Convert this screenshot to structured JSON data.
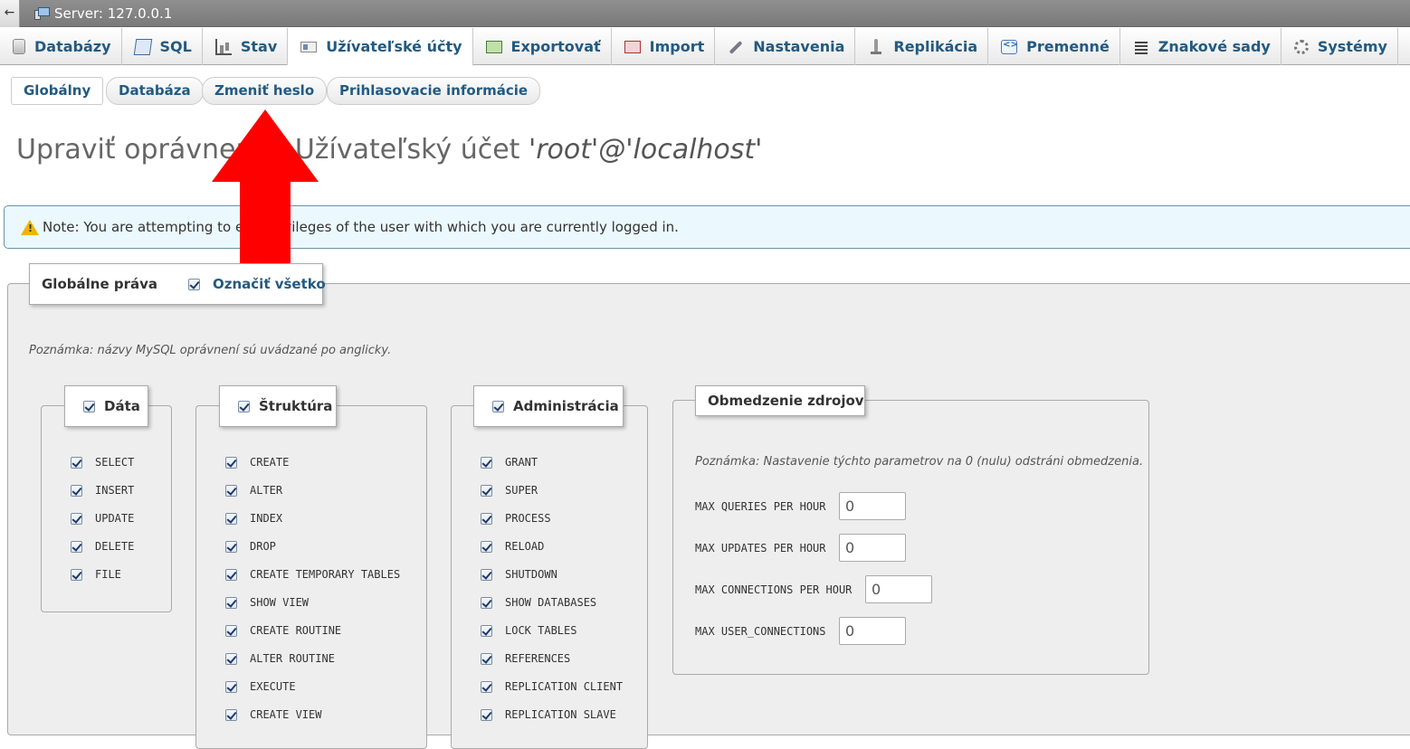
{
  "topbar": {
    "back_symbol": "←",
    "server_label": "Server: 127.0.0.1"
  },
  "tabs": [
    {
      "label": "Databázy",
      "icon": "database-icon"
    },
    {
      "label": "SQL",
      "icon": "sql-icon"
    },
    {
      "label": "Stav",
      "icon": "status-icon"
    },
    {
      "label": "Užívateľské účty",
      "icon": "user-accounts-icon"
    },
    {
      "label": "Exportovať",
      "icon": "export-icon"
    },
    {
      "label": "Import",
      "icon": "import-icon"
    },
    {
      "label": "Nastavenia",
      "icon": "wrench-icon"
    },
    {
      "label": "Replikácia",
      "icon": "replication-icon"
    },
    {
      "label": "Premenné",
      "icon": "variables-icon"
    },
    {
      "label": "Znakové sady",
      "icon": "charset-icon"
    },
    {
      "label": "Systémy",
      "icon": "engines-icon"
    }
  ],
  "subtabs": [
    "Globálny",
    "Databáza",
    "Zmeniť heslo",
    "Prihlasovacie informácie"
  ],
  "page": {
    "title_prefix": "Upraviť oprávnenia: Užívateľský účet ",
    "title_user": "'root'@'localhost'"
  },
  "notice": {
    "text": "Note: You are attempting to edit privileges of the user with which you are currently logged in."
  },
  "global": {
    "legend": "Globálne práva",
    "select_all": "Označiť všetko",
    "hint": "Poznámka: názvy MySQL oprávnení sú uvádzané po anglicky."
  },
  "groups": {
    "data": {
      "legend": "Dáta",
      "items": [
        "SELECT",
        "INSERT",
        "UPDATE",
        "DELETE",
        "FILE"
      ]
    },
    "structure": {
      "legend": "Štruktúra",
      "items": [
        "CREATE",
        "ALTER",
        "INDEX",
        "DROP",
        "CREATE TEMPORARY TABLES",
        "SHOW VIEW",
        "CREATE ROUTINE",
        "ALTER ROUTINE",
        "EXECUTE",
        "CREATE VIEW"
      ]
    },
    "admin": {
      "legend": "Administrácia",
      "items": [
        "GRANT",
        "SUPER",
        "PROCESS",
        "RELOAD",
        "SHUTDOWN",
        "SHOW DATABASES",
        "LOCK TABLES",
        "REFERENCES",
        "REPLICATION CLIENT",
        "REPLICATION SLAVE"
      ]
    }
  },
  "resources": {
    "legend": "Obmedzenie zdrojov",
    "hint": "Poznámka: Nastavenie týchto parametrov na 0 (nulu) odstráni obmedzenia.",
    "rows": [
      {
        "label": "MAX QUERIES PER HOUR",
        "value": "0"
      },
      {
        "label": "MAX UPDATES PER HOUR",
        "value": "0"
      },
      {
        "label": "MAX CONNECTIONS PER HOUR",
        "value": "0"
      },
      {
        "label": "MAX USER_CONNECTIONS",
        "value": "0"
      }
    ]
  },
  "colors": {
    "link": "#235a81",
    "arrow": "#ff0000",
    "notice_bg": "#ebf8fd"
  }
}
